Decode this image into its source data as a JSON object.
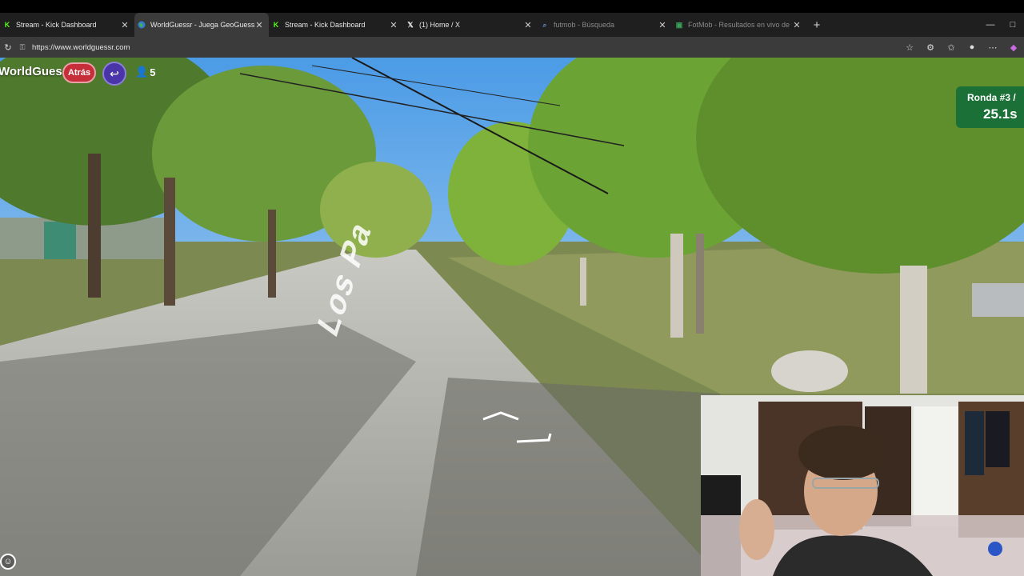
{
  "browser": {
    "tabs": [
      {
        "label": "Stream - Kick Dashboard",
        "favicon": "kick-icon",
        "active": false
      },
      {
        "label": "WorldGuessr - Juega GeoGuessr g",
        "favicon": "globe-icon",
        "active": true
      },
      {
        "label": "Stream - Kick Dashboard",
        "favicon": "kick-icon",
        "active": false
      },
      {
        "label": "(1) Home / X",
        "favicon": "x-icon",
        "active": false
      },
      {
        "label": "futmob - Búsqueda",
        "favicon": "search-icon",
        "active": false
      },
      {
        "label": "FotMob - Resultados en vivo de fu",
        "favicon": "fotmob-icon",
        "active": false
      }
    ],
    "url": "https://www.worldguessr.com",
    "close_glyph": "✕",
    "new_tab_glyph": "+"
  },
  "game": {
    "brand": "WorldGuessr",
    "back_label": "Atrás",
    "players_count": "5",
    "round_label": "Ronda #3 /",
    "timer": "25.1s",
    "street_name": "Los Pa"
  },
  "colors": {
    "back_button": "#c62f3a",
    "return_button": "#4a35a8",
    "round_box": "#166e3a"
  }
}
